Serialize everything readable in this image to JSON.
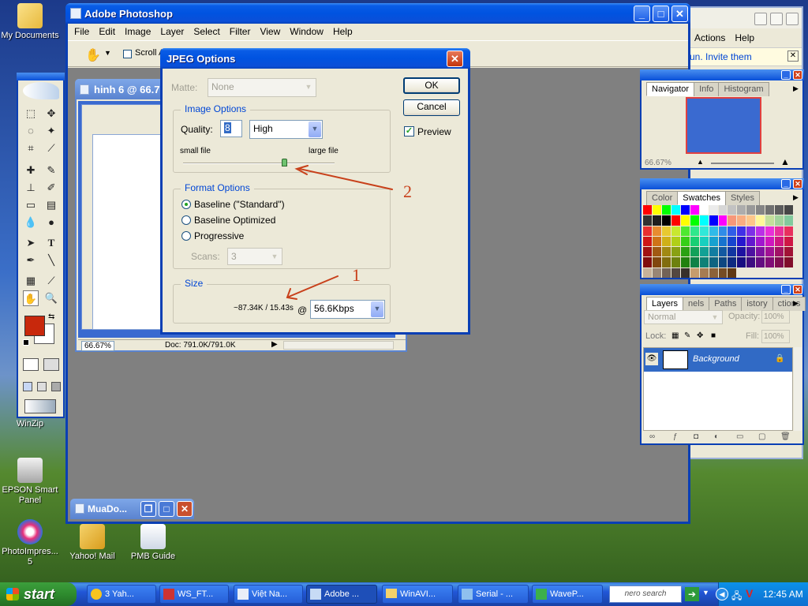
{
  "desktop": {
    "icons": [
      {
        "label": "My Documents"
      },
      {
        "label": "WinZip"
      },
      {
        "label": "EPSON Smart Panel"
      },
      {
        "label": "PhotoImpres... 5"
      },
      {
        "label": "Yahoo! Mail"
      },
      {
        "label": "PMB Guide"
      }
    ]
  },
  "bg_window": {
    "menu": [
      "Actions",
      "Help"
    ],
    "invite_text": "un. Invite them"
  },
  "photoshop": {
    "title": "Adobe Photoshop",
    "menu": [
      "File",
      "Edit",
      "Image",
      "Layer",
      "Select",
      "Filter",
      "View",
      "Window",
      "Help"
    ],
    "options_scroll_label": "Scroll Al",
    "doc_title": "hinh 6 @ 66.7",
    "doc_zoom": "66.67%",
    "doc_size": "Doc: 791.0K/791.0K",
    "minimized_title": "MuaDo..."
  },
  "jpeg_dialog": {
    "title": "JPEG Options",
    "matte_label": "Matte:",
    "matte_value": "None",
    "image_options_label": "Image Options",
    "quality_label": "Quality:",
    "quality_value": "8",
    "quality_preset": "High",
    "small_file": "small file",
    "large_file": "large file",
    "quality_slider_fraction": 0.67,
    "format_options_label": "Format Options",
    "format_options": [
      "Baseline (\"Standard\")",
      "Baseline Optimized",
      "Progressive"
    ],
    "format_selected": 0,
    "scans_label": "Scans:",
    "scans_value": "3",
    "size_label": "Size",
    "size_estimate": "~87.34K / 15.43s",
    "at_symbol": "@",
    "speed_value": "56.6Kbps",
    "ok_label": "OK",
    "cancel_label": "Cancel",
    "preview_label": "Preview",
    "preview_checked": true
  },
  "annotations": {
    "arrow1": "1",
    "arrow2": "2"
  },
  "navigator_panel": {
    "tabs": [
      "Navigator",
      "Info",
      "Histogram"
    ],
    "zoom": "66.67%"
  },
  "color_panel": {
    "tabs": [
      "Color",
      "Swatches",
      "Styles"
    ]
  },
  "layers_panel": {
    "tabs": [
      "Layers",
      "nels",
      "Paths",
      "istory",
      "ctions"
    ],
    "blend_mode": "Normal",
    "opacity_label": "Opacity:",
    "opacity_value": "100%",
    "lock_label": "Lock:",
    "fill_label": "Fill:",
    "fill_value": "100%",
    "layer_name": "Background"
  },
  "taskbar": {
    "start_label": "start",
    "items": [
      "3 Yah...",
      "WS_FT...",
      "Việt Na...",
      "Adobe ...",
      "WinAVI...",
      "Serial - ...",
      "WaveP..."
    ],
    "active_index": 3,
    "search_label": "nero search",
    "clock": "12:45 AM"
  }
}
